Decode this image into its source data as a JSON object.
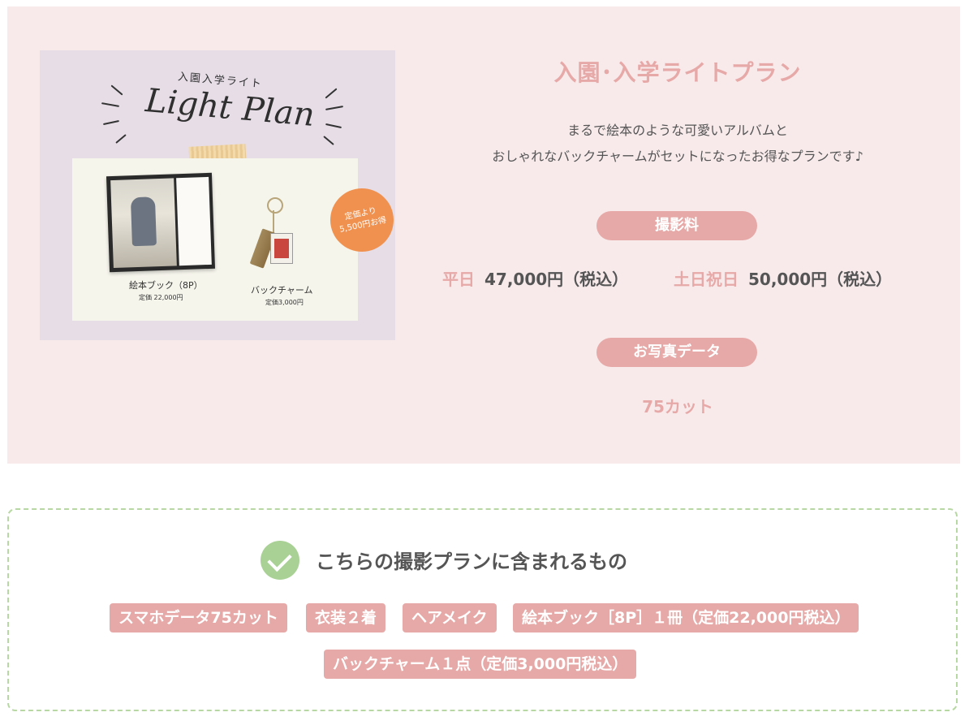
{
  "plan": {
    "title": "入園･入学ライトプラン",
    "description_line1": "まるで絵本のような可愛いアルバムと",
    "description_line2": "おしゃれなバックチャームがセットになったお得なプランです♪",
    "shooting_fee_label": "撮影料",
    "weekday_label": "平日",
    "weekday_price": "47,000円（税込）",
    "weekend_label": "土日祝日",
    "weekend_price": "50,000円（税込）",
    "photo_data_label": "お写真データ",
    "photo_cuts": "75カット"
  },
  "image": {
    "logo_small": "入園入学ライト",
    "logo_main": "Light Plan",
    "book_label": "絵本ブック（8P）",
    "book_price": "定価 22,000円",
    "charm_label": "バックチャーム",
    "charm_price": "定価3,000円",
    "badge_line1": "定価より",
    "badge_line2": "5,500円お得"
  },
  "included": {
    "title": "こちらの撮影プランに含まれるもの",
    "items": [
      "スマホデータ75カット",
      "衣装２着",
      "ヘアメイク",
      "絵本ブック［8P］１冊（定価22,000円税込）",
      "バックチャーム１点（定価3,000円税込）"
    ]
  },
  "colors": {
    "panel_bg": "#f8eaeb",
    "accent_pink": "#e6a9a7",
    "check_green": "#a9d195",
    "dashed_border": "#b8d8a3"
  }
}
